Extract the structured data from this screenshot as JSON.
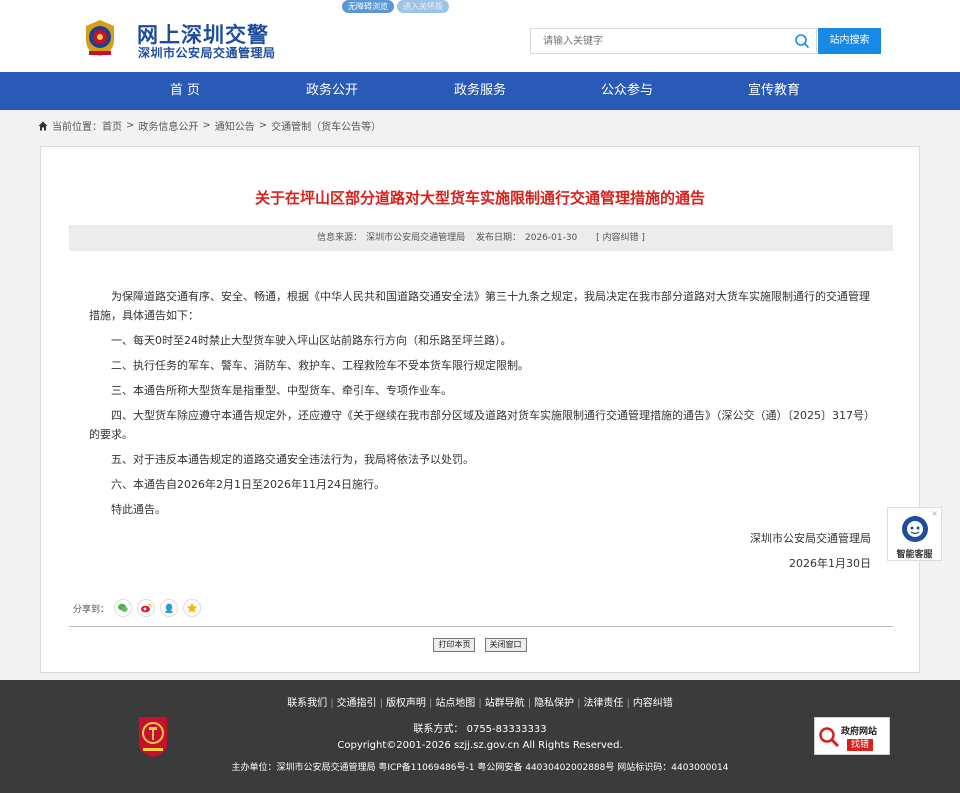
{
  "header": {
    "accessibility": [
      "无障碍浏览",
      "进入关怀版"
    ],
    "site_title": "网上深圳交警",
    "site_subtitle": "深圳市公安局交通管理局",
    "search_placeholder": "请输入关键字",
    "search_button": "站内搜索"
  },
  "nav": [
    "首 页",
    "政务公开",
    "政务服务",
    "公众参与",
    "宣传教育"
  ],
  "breadcrumb": {
    "prefix": "当前位置：",
    "items": [
      "首页",
      "政务信息公开",
      "通知公告",
      "交通管制（货车公告等）"
    ],
    "separator": ">"
  },
  "article": {
    "title": "关于在坪山区部分道路对大型货车实施限制通行交通管理措施的通告",
    "meta": {
      "source_label": "信息来源：",
      "source": "深圳市公安局交通管理局",
      "date_label": "发布日期：",
      "date": "2026-01-30",
      "report": "[ 内容纠错 ]"
    },
    "paragraphs": [
      "为保障道路交通有序、安全、畅通，根据《中华人民共和国道路交通安全法》第三十九条之规定，我局决定在我市部分道路对大货车实施限制通行的交通管理措施，具体通告如下：",
      "一、每天0时至24时禁止大型货车驶入坪山区站前路东行方向（和乐路至坪兰路）。",
      "二、执行任务的军车、警车、消防车、救护车、工程救险车不受本货车限行规定限制。",
      "三、本通告所称大型货车是指重型、中型货车、牵引车、专项作业车。",
      "四、大型货车除应遵守本通告规定外，还应遵守《关于继续在我市部分区域及道路对货车实施限制通行交通管理措施的通告》（深公交（通）〔2025〕317号）的要求。",
      "五、对于违反本通告规定的道路交通安全违法行为，我局将依法予以处罚。",
      "六、本通告自2026年2月1日至2026年11月24日施行。",
      "特此通告。"
    ],
    "signature": "深圳市公安局交通管理局",
    "sign_date": "2026年1月30日",
    "share_label": "分享到："
  },
  "buttons": {
    "print": "打印本页",
    "close": "关闭窗口"
  },
  "service": {
    "label": "智能客服",
    "close": "×"
  },
  "footer": {
    "links": [
      "联系我们",
      "交通指引",
      "版权声明",
      "站点地图",
      "站群导航",
      "隐私保护",
      "法律责任",
      "内容纠错"
    ],
    "contact": "联系方式：  0755-83333333",
    "copyright": "Copyright©2001-2026 szjj.sz.gov.cn   All Rights Reserved.",
    "org": "主办单位：深圳市公安局交通管理局   粤ICP备11069486号-1   粤公网安备 44030402002888号   网站标识码：4403000014",
    "gov_badge_top": "政府网站",
    "gov_badge_bottom": "找错"
  },
  "colors": {
    "nav": "#2a5ab8",
    "title_red": "#d9211b",
    "brand_blue": "#1f4d9e",
    "search_button": "#1989e6",
    "footer": "#3b3b3b"
  }
}
